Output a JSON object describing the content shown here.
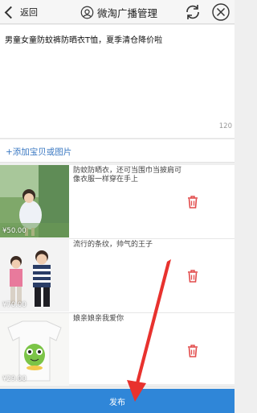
{
  "header": {
    "back_label": "返回",
    "title": "微淘广播管理"
  },
  "compose": {
    "text": "男童女童防蚊裤防晒衣T恤，夏季清仓降价啦",
    "count": "120"
  },
  "add": {
    "label": "+添加宝贝或图片"
  },
  "items": [
    {
      "price": "¥50.00",
      "desc": "防蚊防晒衣，还可当围巾当披肩可像衣服一样穿在手上"
    },
    {
      "price": "¥70.00",
      "desc": "流行的条纹，帅气的王子"
    },
    {
      "price": "¥29.00",
      "desc": "娘亲娘亲我爱你"
    }
  ],
  "footer": {
    "publish_label": "发布"
  },
  "colors": {
    "accent": "#2f86d8",
    "link": "#3a78c2",
    "delete": "#e24b4b",
    "annotation_arrow": "#e8322e"
  }
}
